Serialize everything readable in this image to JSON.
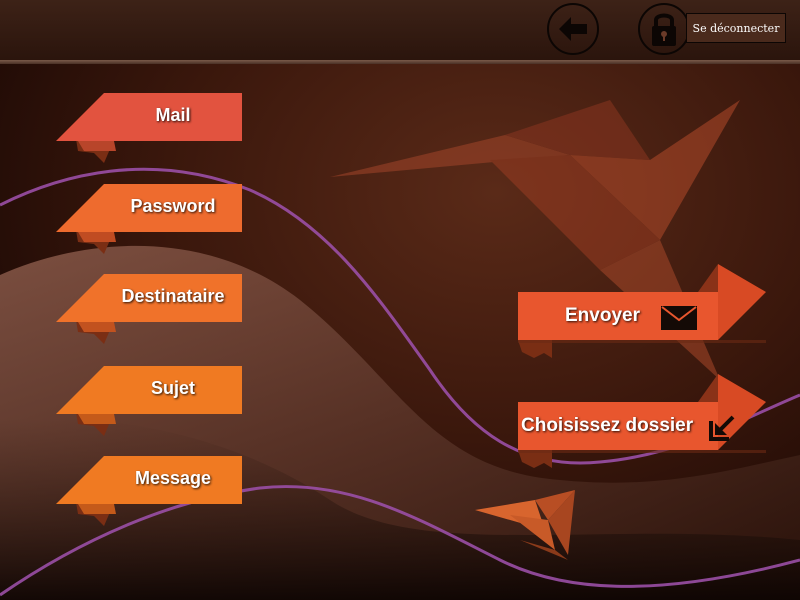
{
  "header": {
    "back_icon": "arrow-left-icon",
    "lock_icon": "lock-icon",
    "logout_label": "Se déconnecter"
  },
  "form": {
    "fields": [
      {
        "label": "Mail"
      },
      {
        "label": "Password"
      },
      {
        "label": "Destinataire"
      },
      {
        "label": "Sujet"
      },
      {
        "label": "Message"
      }
    ]
  },
  "actions": {
    "send_label": "Envoyer",
    "send_icon": "envelope-icon",
    "choose_folder_label": "Choisissez dossier",
    "choose_folder_icon": "folder-import-icon"
  },
  "colors": {
    "ribbon_orange": "#f0722a",
    "ribbon_red": "#e2533f",
    "background": "#2d130a",
    "accent_purple": "#9a4fa6"
  }
}
